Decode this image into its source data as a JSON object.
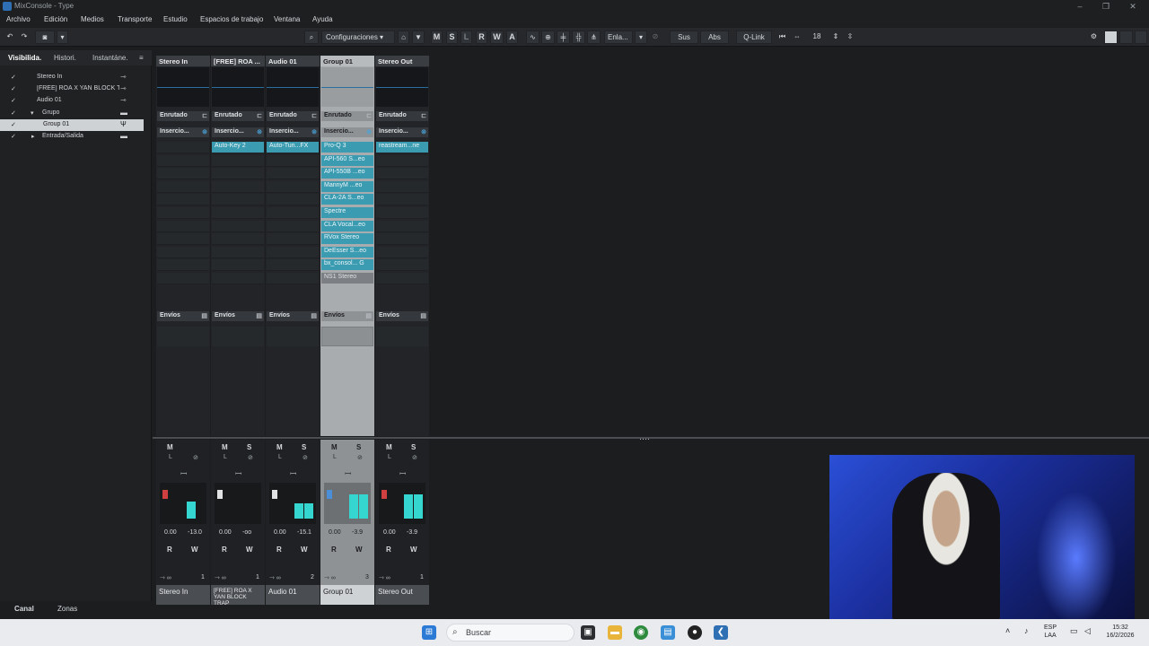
{
  "window": {
    "title": "MixConsole - Type"
  },
  "menu": [
    "Archivo",
    "Edición",
    "Medios",
    "Transporte",
    "Estudio",
    "Espacios de trabajo",
    "Ventana",
    "Ayuda"
  ],
  "toolbar": {
    "config_label": "Configuraciones",
    "mode_buttons": [
      "M",
      "S",
      "L",
      "R",
      "W",
      "A"
    ],
    "link_label": "Enla...",
    "sus_label": "Sus",
    "abs_label": "Abs",
    "qlink_label": "Q-Link",
    "channel_count": "18"
  },
  "left_panel": {
    "tabs": [
      "Visibilida.",
      "Histori.",
      "Instantáne."
    ],
    "tree": [
      {
        "label": "Stereo In",
        "checked": true,
        "indent": 0
      },
      {
        "label": "[FREE] ROA X YAN BLOCK T",
        "checked": true,
        "indent": 0
      },
      {
        "label": "Audio 01",
        "checked": true,
        "indent": 0
      },
      {
        "label": "Grupo",
        "checked": true,
        "indent": 0
      },
      {
        "label": "Group 01",
        "checked": true,
        "indent": 1
      },
      {
        "label": "Entrada/Salida",
        "checked": true,
        "indent": 0
      }
    ],
    "bottom_tabs": [
      "Canal",
      "Zonas"
    ]
  },
  "sections": {
    "routing": "Enrutado",
    "inserts": "Insercio...",
    "sends": "Envíos"
  },
  "channels": [
    {
      "header": "Stereo In",
      "name": "Stereo In",
      "inserts": [],
      "vol": "0.00",
      "peak": "-13.0",
      "num": "1",
      "meter": 0.55
    },
    {
      "header": "[FREE] ROA ...",
      "name": "[FREE] ROA X YAN BLOCK TRAP",
      "inserts": [
        "Auto-Key 2"
      ],
      "vol": "0.00",
      "peak": "-oo",
      "num": "1",
      "meter": 0.0
    },
    {
      "header": "Audio 01",
      "name": "Audio 01",
      "inserts": [
        "Auto-Tun...FX"
      ],
      "vol": "0.00",
      "peak": "-15.1",
      "num": "2",
      "meter": 0.5
    },
    {
      "header": "Group 01",
      "name": "Group 01",
      "inserts": [
        "Pro-Q 3",
        "API-560 S...eo",
        "API-550B ...eo",
        "MannyM ...eo",
        "CLA-2A S...eo",
        "Spectre",
        "CLA Vocal...eo",
        "RVox Stereo",
        "DeEsser S...eo",
        "bx_consol... G"
      ],
      "inserts_inactive": [
        "NS1 Stereo"
      ],
      "vol": "0.00",
      "peak": "-3.9",
      "num": "3",
      "meter": 0.8
    },
    {
      "header": "Stereo Out",
      "name": "Stereo Out",
      "inserts": [
        "reastream...ne"
      ],
      "vol": "0.00",
      "peak": "-3.9",
      "num": "1",
      "meter": 0.8
    }
  ],
  "strip_labels": {
    "mute": "M",
    "solo": "S",
    "read": "R",
    "write": "W",
    "listen": "L"
  },
  "taskbar": {
    "search_placeholder": "Buscar",
    "lang": "ESP",
    "lang2": "LAA",
    "time": "15:32",
    "date": "16/2/2026"
  }
}
